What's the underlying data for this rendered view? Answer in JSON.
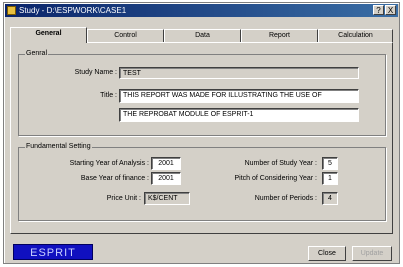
{
  "window": {
    "title": "Study - D:\\ESPWORK\\CASE1",
    "help_label": "?",
    "close_label": "X"
  },
  "tabs": [
    {
      "label": "General"
    },
    {
      "label": "Control"
    },
    {
      "label": "Data"
    },
    {
      "label": "Report"
    },
    {
      "label": "Calculation"
    }
  ],
  "general": {
    "group_label": "Genral",
    "study_name_label": "Study Name :",
    "study_name_value": "TEST",
    "title_label": "Title :",
    "title_line1": "THIS REPORT WAS MADE FOR ILLUSTRATING THE USE OF",
    "title_line2": "THE REPROBAT MODULE OF ESPRIT-1"
  },
  "fundamental": {
    "group_label": "Fundamental Setting",
    "start_year_label": "Starting Year of Analysis :",
    "start_year_value": "2001",
    "base_year_label": "Base Year of finance :",
    "base_year_value": "2001",
    "price_unit_label": "Price Unit :",
    "price_unit_value": "K$/CENT",
    "num_study_year_label": "Number of Study Year :",
    "num_study_year_value": "5",
    "pitch_label": "Pitch of Considering Year :",
    "pitch_value": "1",
    "num_periods_label": "Number of Periods :",
    "num_periods_value": "4"
  },
  "footer": {
    "logo_text": "ESPRIT",
    "close_label": "Close",
    "update_label": "Update"
  }
}
